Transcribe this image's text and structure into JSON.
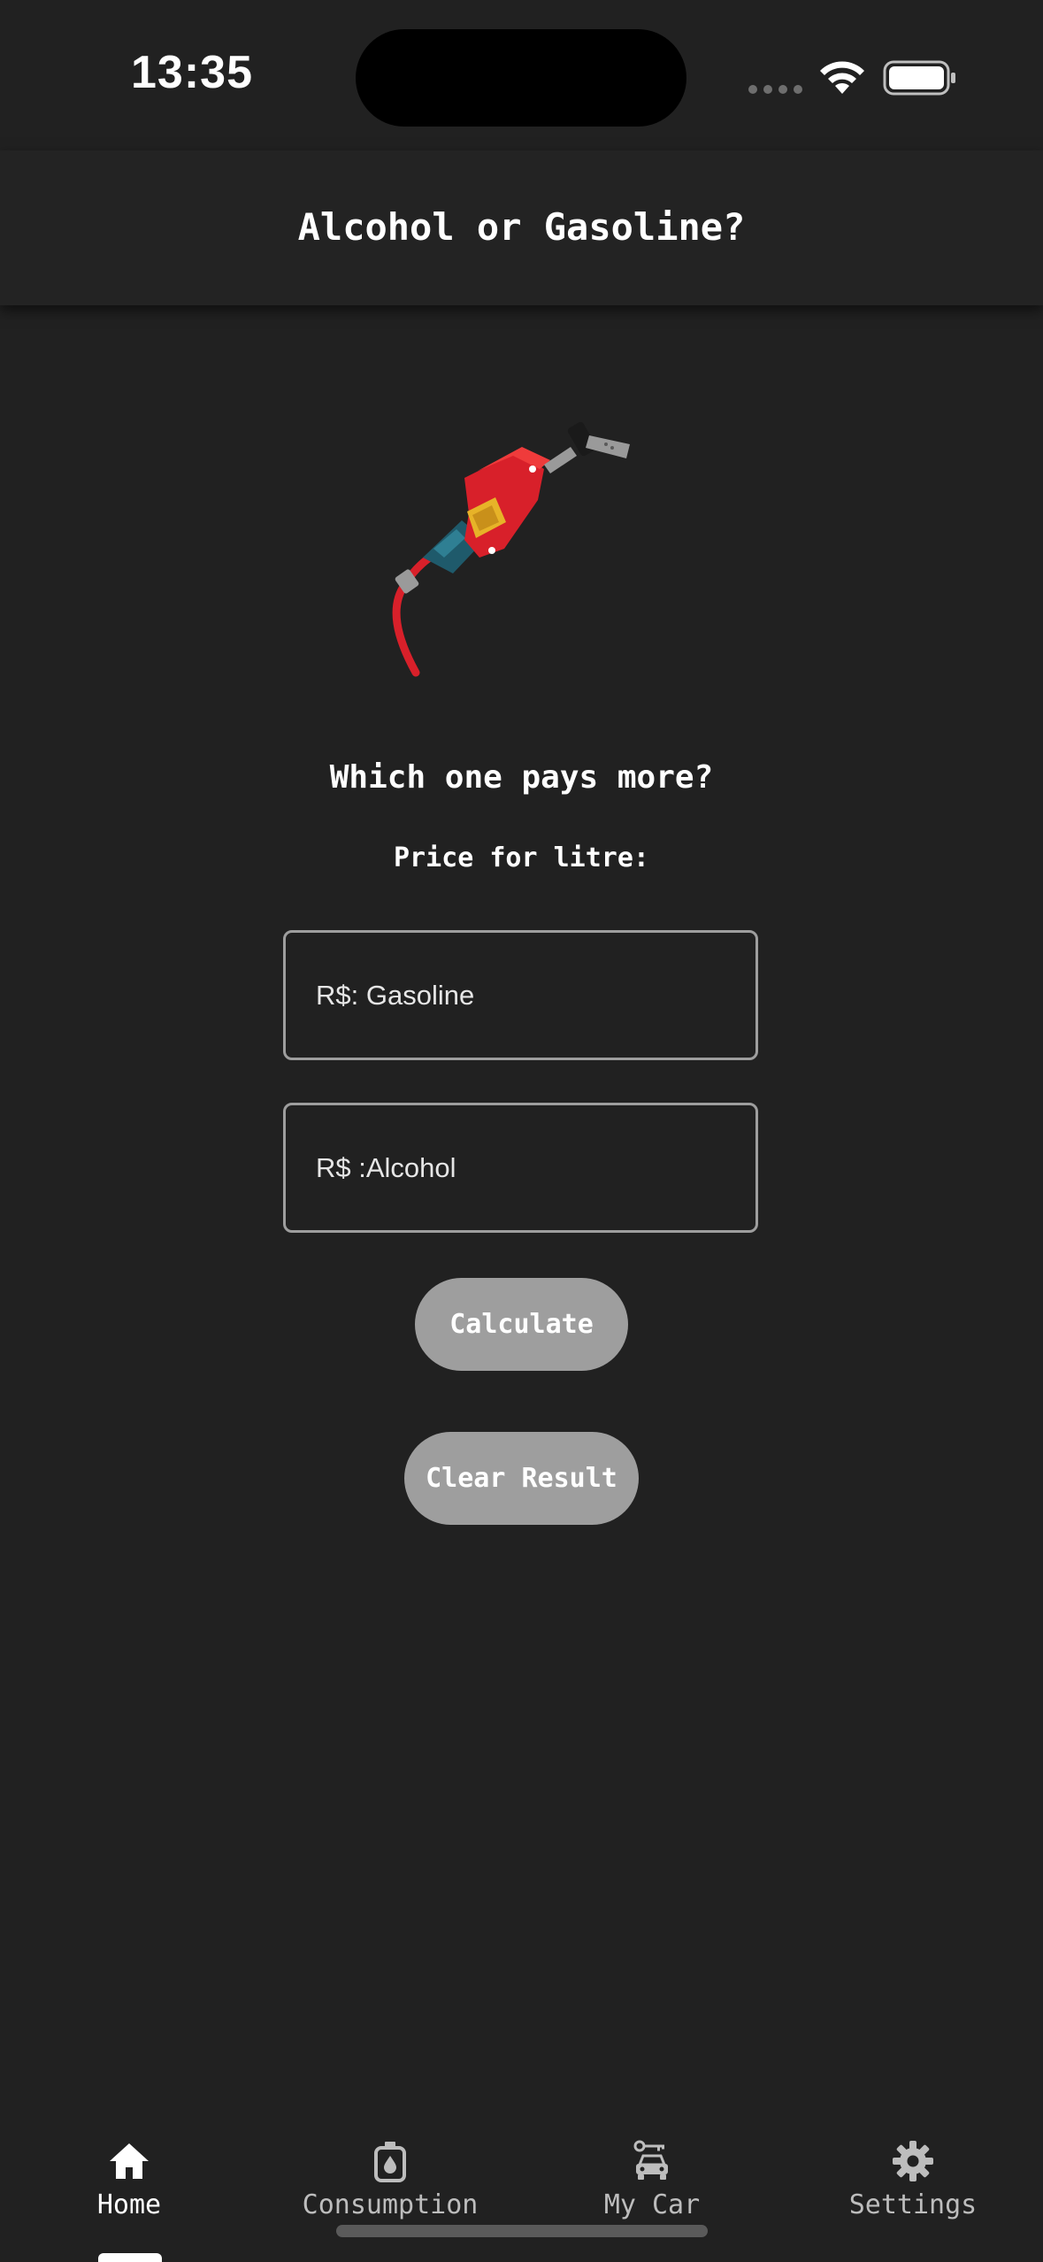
{
  "status_bar": {
    "time": "13:35"
  },
  "app_bar": {
    "title": "Alcohol or Gasoline?"
  },
  "content": {
    "illustration_icon": "fuel-pump-nozzle-icon",
    "question": "Which one pays more?",
    "price_label": "Price for litre:",
    "gasoline_field": {
      "placeholder": "R$: Gasoline",
      "value": ""
    },
    "alcohol_field": {
      "placeholder": "R$ :Alcohol",
      "value": ""
    },
    "calculate_label": "Calculate",
    "clear_label": "Clear Result"
  },
  "bottom_nav": {
    "items": [
      {
        "label": "Home",
        "icon": "home-icon",
        "active": true
      },
      {
        "label": "Consumption",
        "icon": "fuel-consumption-icon",
        "active": false
      },
      {
        "label": "My Car",
        "icon": "car-icon",
        "active": false
      },
      {
        "label": "Settings",
        "icon": "gear-icon",
        "active": false
      }
    ]
  },
  "colors": {
    "background": "#212121",
    "app_bar": "#232323",
    "button": "#9e9e9e",
    "field_border": "#9e9e9e",
    "text": "#ffffff",
    "nav_inactive": "#bdbdbd"
  }
}
